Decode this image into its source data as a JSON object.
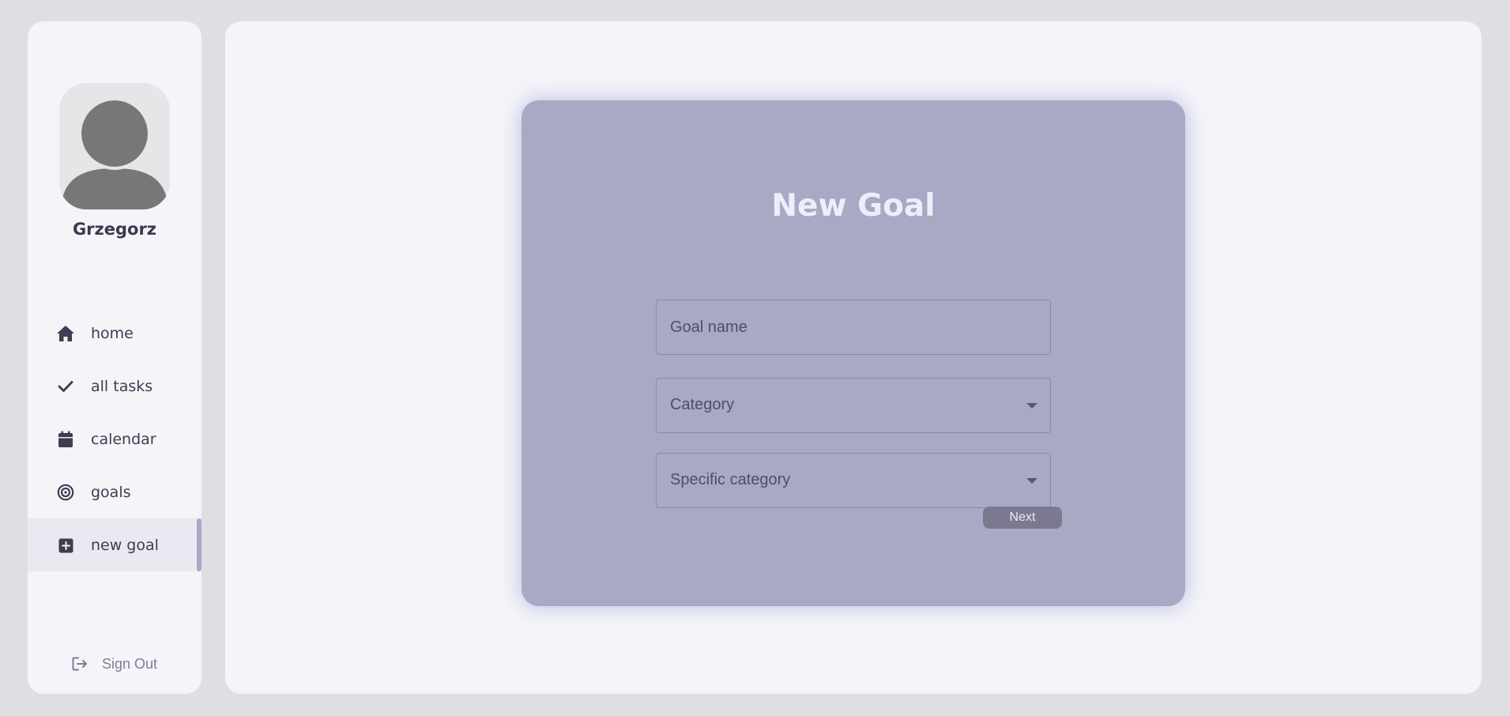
{
  "user": {
    "name": "Grzegorz"
  },
  "sidebar": {
    "items": [
      {
        "label": "home",
        "icon": "home-icon"
      },
      {
        "label": "all tasks",
        "icon": "check-icon"
      },
      {
        "label": "calendar",
        "icon": "calendar-icon"
      },
      {
        "label": "goals",
        "icon": "target-icon"
      },
      {
        "label": "new goal",
        "icon": "plus-square-icon",
        "active": true
      }
    ],
    "sign_out_label": "Sign Out",
    "sign_out_icon": "sign-out-icon"
  },
  "form": {
    "title": "New Goal",
    "goal_name": {
      "placeholder": "Goal name",
      "value": ""
    },
    "category": {
      "label": "Category"
    },
    "specific_category": {
      "label": "Specific category"
    },
    "next_label": "Next"
  },
  "colors": {
    "page_background": "#dfdee3",
    "panel_background": "#f4f4f9",
    "card_background": "#a9a9c6",
    "text_dark": "#3b3a50",
    "button": "#7a798f"
  }
}
